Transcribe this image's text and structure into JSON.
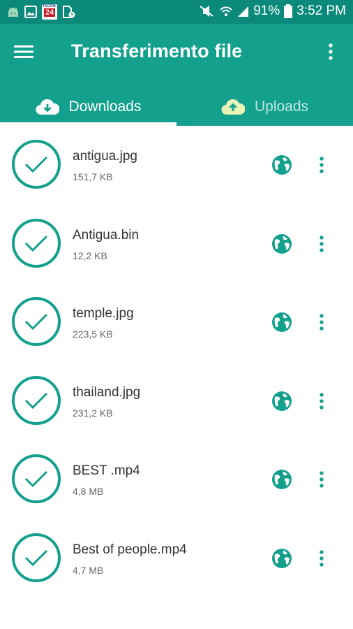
{
  "status_bar": {
    "news_badge_top": "TGCOM",
    "news_badge_num": "24",
    "battery": "91%",
    "time": "3:52 PM"
  },
  "app_bar": {
    "title": "Transferimento file",
    "menu_icon": "hamburger-menu-icon",
    "more_icon": "more-vert-icon"
  },
  "tabs": [
    {
      "label": "Downloads",
      "icon": "cloud-download-icon",
      "selected": true
    },
    {
      "label": "Uploads",
      "icon": "cloud-upload-icon",
      "selected": false
    }
  ],
  "files": [
    {
      "name": "antigua.jpg",
      "size": "151,7 KB"
    },
    {
      "name": "Antigua.bin",
      "size": "12,2 KB"
    },
    {
      "name": "temple.jpg",
      "size": "223,5 KB"
    },
    {
      "name": "thailand.jpg",
      "size": "231,2 KB"
    },
    {
      "name": "BEST .mp4",
      "size": "4,8 MB"
    },
    {
      "name": "Best of people.mp4",
      "size": "4,7 MB"
    }
  ],
  "colors": {
    "status_bar": "#0b8a7b",
    "app_bar": "#13a08d",
    "accent": "#13a08d",
    "upload_icon": "#e8f3b5"
  }
}
